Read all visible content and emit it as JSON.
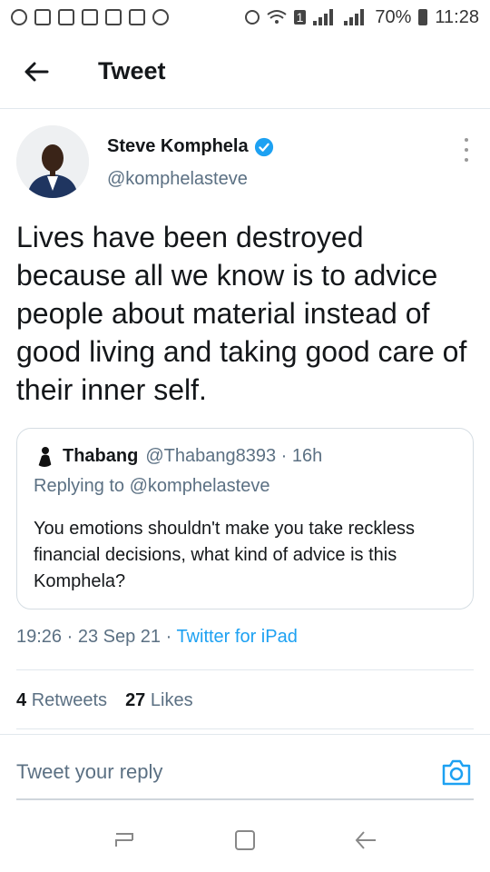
{
  "status_bar": {
    "battery": "70%",
    "time": "11:28",
    "sim_badge": "1"
  },
  "header": {
    "title": "Tweet"
  },
  "tweet": {
    "author_name": "Steve Komphela",
    "author_handle": "@komphelasteve",
    "text": "Lives have been destroyed because all we know is to advice people about material instead of good living and taking good care of their inner self.",
    "timestamp": "19:26 · 23 Sep 21 · ",
    "source": "Twitter for iPad",
    "retweets_count": "4",
    "retweets_label": "Retweets",
    "likes_count": "27",
    "likes_label": "Likes"
  },
  "quoted_tweet": {
    "name": "Thabang",
    "handle_time": "@Thabang8393 · 16h",
    "replying_to": "Replying to @komphelasteve",
    "text": "You emotions shouldn't make you take reckless financial decisions, what kind of advice is this Komphela?"
  },
  "reply": {
    "placeholder": "Tweet your reply"
  },
  "colors": {
    "accent": "#1da1f2",
    "secondary_text": "#5b7083",
    "primary_text": "#14171a"
  }
}
